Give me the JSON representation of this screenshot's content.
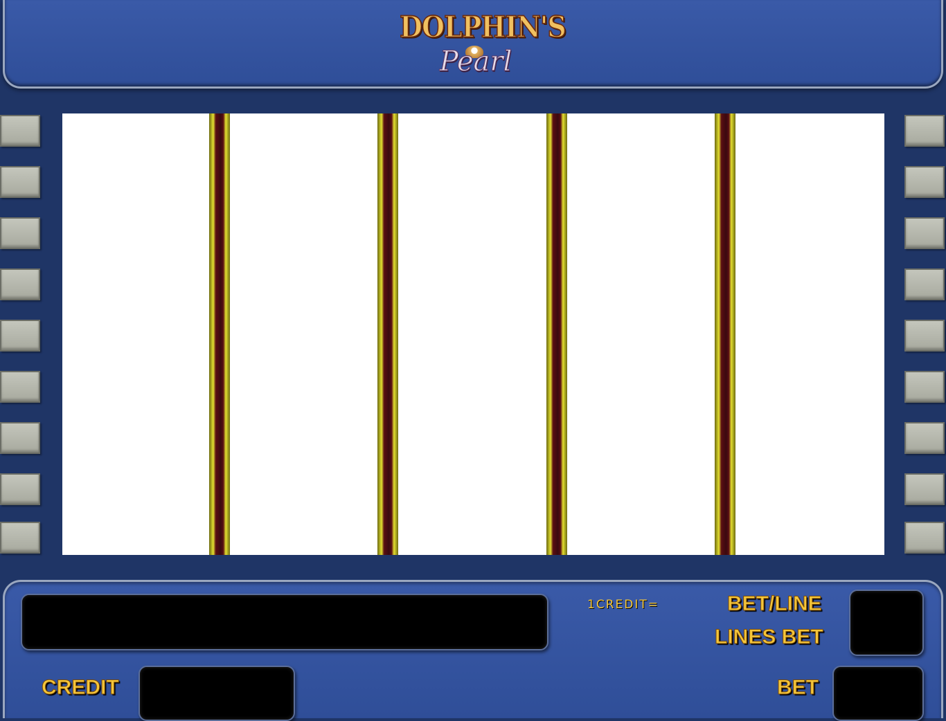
{
  "logo": {
    "title": "DOLPHIN'S",
    "subtitle": "Pearl"
  },
  "reels": {
    "count": 5
  },
  "paylines": {
    "left_markers": 9,
    "right_markers": 9
  },
  "info": {
    "credit_value_label": "1CREDIT=",
    "bet_per_line_label": "BET/LINE",
    "lines_bet_label": "LINES BET",
    "credit_label": "CREDIT",
    "bet_label": "BET"
  },
  "colors": {
    "panel_blue": "#2f4e98",
    "label_gold": "#f4c63a",
    "divider_gold": "#e4e030",
    "divider_maroon": "#3a0a10"
  }
}
